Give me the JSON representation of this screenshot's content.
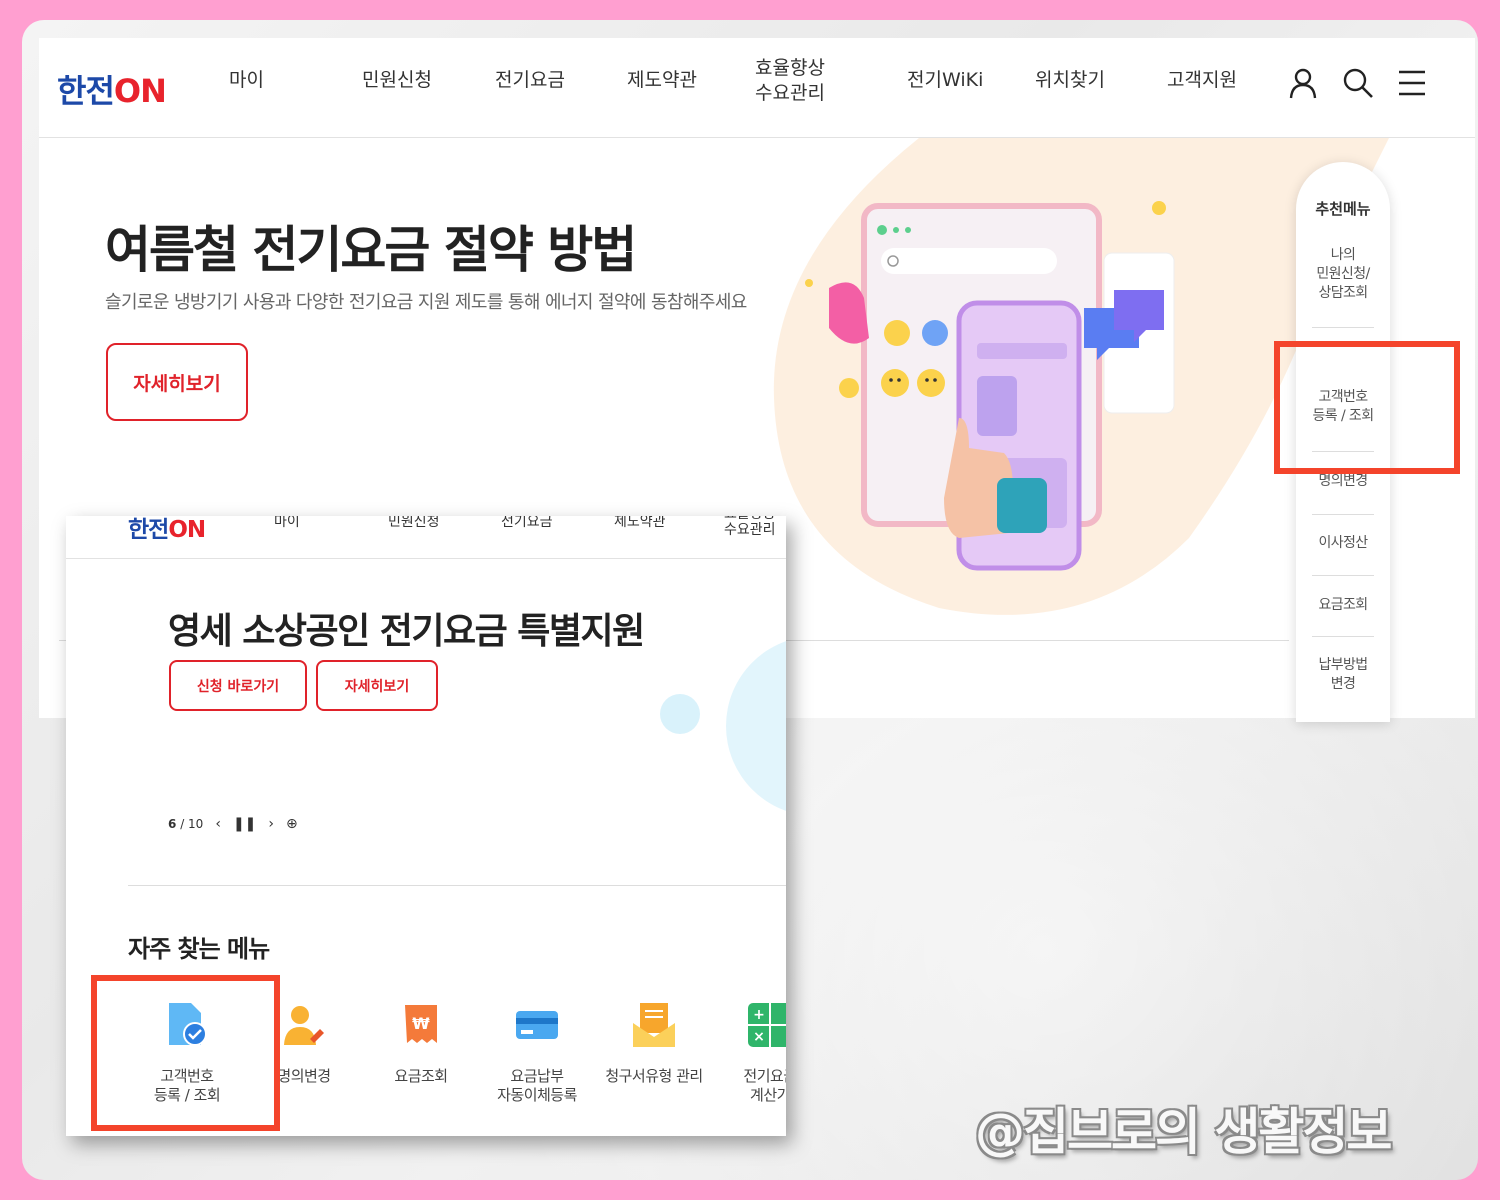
{
  "header": {
    "logo_main": "한전",
    "logo_on": "ON",
    "nav": [
      "마이",
      "민원신청",
      "전기요금",
      "제도약관",
      "효율향상\n수요관리",
      "전기WiKi",
      "위치찾기",
      "고객지원"
    ]
  },
  "hero": {
    "title": "여름철 전기요금 절약 방법",
    "subtitle": "슬기로운 냉방기기 사용과 다양한 전기요금 지원 제도를 통해 에너지 절약에 동참해주세요",
    "detail_button": "자세히보기"
  },
  "recommended": {
    "title": "추천메뉴",
    "items": [
      "나의\n민원신청/\n상담조회",
      "고객번호\n등록 / 조회",
      "명의변경",
      "이사정산",
      "요금조회",
      "납부방법\n변경"
    ]
  },
  "second": {
    "header": {
      "logo_main": "한전",
      "logo_on": "ON",
      "nav": [
        "마이",
        "민원신청",
        "전기요금",
        "제도약관",
        "효율향상\n수요관리"
      ]
    },
    "title": "영세 소상공인 전기요금 특별지원",
    "apply_button": "신청 바로가기",
    "detail_button": "자세히보기",
    "pager": {
      "current": "6",
      "total": "/ 10"
    },
    "frequent_title": "자주 찾는 메뉴",
    "frequent_items": [
      "고객번호\n등록 / 조회",
      "명의변경",
      "요금조회",
      "요금납부\n자동이체등록",
      "청구서유형 관리",
      "전기요금\n계산기"
    ]
  },
  "watermark": "@집브로의 생활정보",
  "colors": {
    "background": "#ff9fd0",
    "brand_blue": "#1d49a8",
    "brand_red": "#e0222a",
    "highlight": "#f4442b"
  }
}
